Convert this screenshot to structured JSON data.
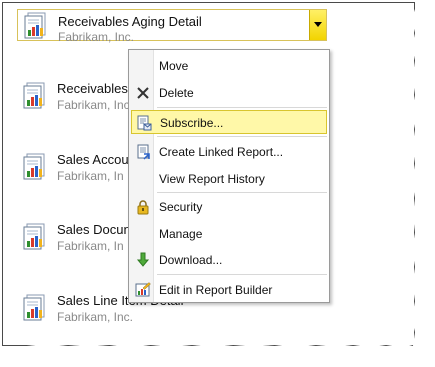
{
  "reports": [
    {
      "title": "Receivables Aging Detail",
      "subtitle": "Fabrikam, Inc."
    },
    {
      "title": "Receivables",
      "subtitle": "Fabrikam, Inc."
    },
    {
      "title": "Sales Accou",
      "subtitle": "Fabrikam, In"
    },
    {
      "title": "Sales Docun",
      "subtitle": "Fabrikam, In"
    },
    {
      "title": "Sales Line Item Detail",
      "subtitle": "Fabrikam, Inc."
    }
  ],
  "menu": {
    "items": [
      {
        "label": "Move",
        "icon": "none"
      },
      {
        "label": "Delete",
        "icon": "close-x"
      },
      {
        "label": "Subscribe...",
        "icon": "subscribe-document"
      },
      {
        "label": "Create Linked Report...",
        "icon": "linked-report"
      },
      {
        "label": "View Report History",
        "icon": "none"
      },
      {
        "label": "Security",
        "icon": "lock"
      },
      {
        "label": "Manage",
        "icon": "none"
      },
      {
        "label": "Download...",
        "icon": "download-arrow"
      },
      {
        "label": "Edit in Report Builder",
        "icon": "report-builder"
      }
    ],
    "highlighted": "Subscribe..."
  },
  "colors": {
    "highlight_bg": "#fff8a8",
    "highlight_border": "#d8c52e",
    "dropdown_yellow": "#f2d400",
    "subtitle_gray": "#8a8a8a"
  }
}
